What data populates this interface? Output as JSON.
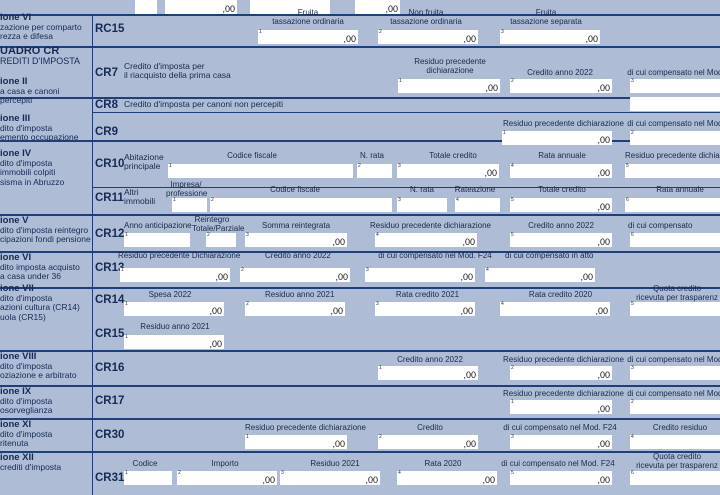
{
  "zero": ",00",
  "top": {
    "sec_lines": [
      "ione VI",
      "zazione per comparto",
      "rezza e difesa"
    ],
    "code": "RC15",
    "labels": [
      "Fruita\ntassazione ordinaria",
      "Non fruita\ntassazione ordinaria",
      "Fruita\ntassazione separata"
    ]
  },
  "quadro": {
    "title": "UADRO CR",
    "subtitle": "REDITI D'IMPOSTA"
  },
  "s2": {
    "lines": [
      "ione II",
      "a casa e canoni",
      "percepiti"
    ]
  },
  "cr7": {
    "code": "CR7",
    "desc": "Credito d'imposta per\nil riacquisto della prima casa",
    "labels": [
      "Residuo precedente\ndichiarazione",
      "Credito anno 2022",
      "di cui compensato nel Mod."
    ]
  },
  "cr8": {
    "code": "CR8",
    "desc": "Credito d'imposta per canoni non percepiti"
  },
  "s3": {
    "lines": [
      "ione III",
      "dito d'imposta",
      "emento occupazione"
    ]
  },
  "cr9": {
    "code": "CR9",
    "labels": [
      "Residuo precedente dichiarazione",
      "di cui compensato nel Mod."
    ]
  },
  "s4": {
    "lines": [
      "ione IV",
      "dito d'imposta",
      "immobili colpiti",
      "sisma in Abruzzo"
    ]
  },
  "cr10": {
    "code": "CR10",
    "desc": "Abitazione\nprincipale",
    "labels": [
      "Codice fiscale",
      "N. rata",
      "Totale credito",
      "Rata annuale",
      "Residuo precedente dichiar"
    ]
  },
  "cr11": {
    "code": "CR11",
    "desc": "Altri\nimmobili",
    "labels": [
      "Impresa/\nprofessione",
      "Codice fiscale",
      "N. rata",
      "Rateazione",
      "Totale credito",
      "Rata annuale"
    ]
  },
  "s5": {
    "lines": [
      "ione V",
      "dito d'imposta reintegro",
      "cipazioni fondi pensione"
    ]
  },
  "cr12": {
    "code": "CR12",
    "labels": [
      "Anno anticipazione",
      "Reintegro\nTotale/Parziale",
      "Somma reintegrata",
      "Residuo precedente dichiarazione",
      "Credito anno 2022",
      "di cui compensato"
    ]
  },
  "s6": {
    "lines": [
      "ione VI",
      "dito imposta acquisto",
      "a casa under 36"
    ]
  },
  "cr13": {
    "code": "CR13",
    "labels": [
      "Residuo precedente Dichiarazione",
      "Credito anno 2022",
      "di cui compensato nel Mod. F24",
      "di cui compensato in atto"
    ]
  },
  "s7": {
    "lines": [
      "ione VII",
      "dito d'imposta",
      "azioni cultura (CR14)",
      "uola (CR15)"
    ]
  },
  "cr14": {
    "code": "CR14",
    "labels": [
      "Spesa 2022",
      "Residuo anno 2021",
      "Rata credito 2021",
      "Rata credito 2020",
      "Quota credito\nricevuta per trasparenz"
    ]
  },
  "cr15": {
    "code": "CR15",
    "labels": [
      "Residuo anno 2021"
    ]
  },
  "s8": {
    "lines": [
      "ione VIII",
      "dito d'imposta",
      "oziazione e arbitrato"
    ]
  },
  "cr16": {
    "code": "CR16",
    "labels": [
      "Credito anno 2022",
      "Residuo precedente dichiarazione",
      "di cui compensato nel Mod."
    ]
  },
  "s9": {
    "lines": [
      "ione IX",
      "dito d'imposta",
      "osorveglianza"
    ]
  },
  "cr17": {
    "code": "CR17",
    "labels": [
      "Residuo precedente dichiarazione",
      "di cui compensato nel Mod."
    ]
  },
  "s10": {
    "lines": [
      "ione XI",
      "dito d'imposta",
      "ritenuta"
    ]
  },
  "cr30": {
    "code": "CR30",
    "labels": [
      "Residuo precedente dichiarazione",
      "Credito",
      "di cui compensato nel Mod. F24",
      "Credito residuo"
    ]
  },
  "s11": {
    "lines": [
      "ione XII",
      "crediti d'imposta"
    ]
  },
  "cr31": {
    "code": "CR31",
    "labels": [
      "Codice",
      "Importo",
      "Residuo 2021",
      "Rata 2020",
      "di cui compensato nel Mod. F24",
      "Quota credito\nricevuta per trasparenz"
    ]
  }
}
